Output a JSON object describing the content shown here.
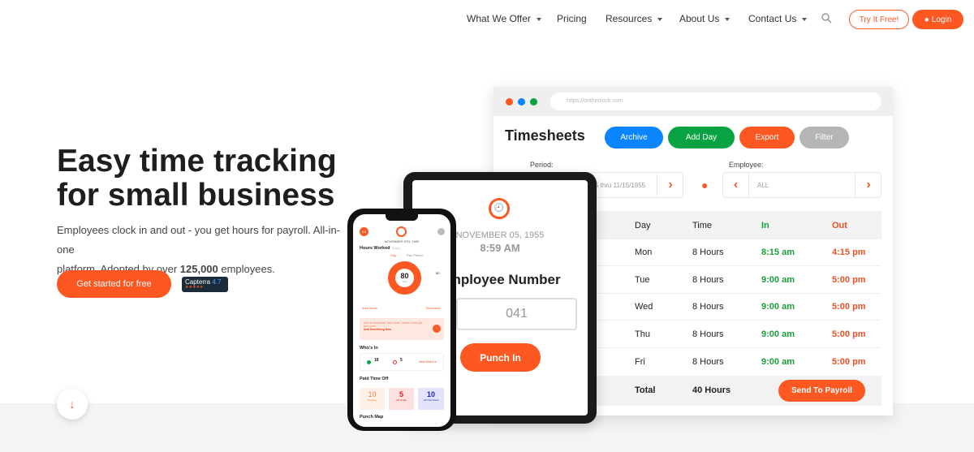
{
  "nav": {
    "items": [
      "What We Offer",
      "Pricing",
      "Resources",
      "About Us",
      "Contact Us"
    ],
    "try_free": "Try It Free!",
    "login": "Login"
  },
  "hero": {
    "title_line1": "Easy time tracking",
    "title_line2": "for small business",
    "desc_1": "Employees clock in and out - you get hours for payroll. All-in-one",
    "desc_2a": "platform. Adopted by over ",
    "desc_2b": "125,000",
    "desc_2c": " employees.",
    "cta": "Get started for free",
    "capterra": "Capterra",
    "capterra_rating": "4.7"
  },
  "browser": {
    "url": "https://ontheclock.com",
    "title": "Timesheets",
    "buttons": {
      "archive": "Archive",
      "add_day": "Add Day",
      "export": "Export",
      "filter": "Filter"
    },
    "period_label": "Period:",
    "period_value": "5 thru 11/15/1955",
    "employee_label": "Employee:",
    "employee_value": "ALL",
    "headers": [
      "Day",
      "Time",
      "In",
      "Out"
    ],
    "rows": [
      [
        "Mon",
        "8 Hours",
        "8:15 am",
        "4:15 pm"
      ],
      [
        "Tue",
        "8 Hours",
        "9:00 am",
        "5:00 pm"
      ],
      [
        "Wed",
        "8 Hours",
        "9:00 am",
        "5:00 pm"
      ],
      [
        "Thu",
        "8 Hours",
        "9:00 am",
        "5:00 pm"
      ],
      [
        "Fri",
        "8 Hours",
        "9:00 am",
        "5:00 pm"
      ]
    ],
    "total_label": "Total",
    "total_value": "40 Hours",
    "send": "Send To Payroll"
  },
  "tablet": {
    "date": "NOVEMBER 05, 1955",
    "time": "8:59 AM",
    "heading": "Employee Number",
    "input": "041",
    "punch": "Punch In"
  },
  "phone": {
    "avatar": "EN",
    "date": "NOVEMBER 5TH, 1955",
    "hours_worked": "Hours Worked",
    "today": "Today",
    "tab_day": "Day",
    "tab_pay": "Pay Period",
    "total": "80",
    "total_label": "Total",
    "side_value": "80",
    "add_hours": "Add Hours",
    "timecards": "Timecards",
    "promo": "Add an employee, add hours, create a new job and more.",
    "promo_link": "Add Something New",
    "whos_in": "Who's In",
    "in_count": "18",
    "in_label": "In",
    "out_count": "5",
    "out_label": "Out",
    "view": "View Who's In",
    "pto": "Paid Time Off",
    "pto_pending": "10",
    "pto_pending_label": "Pending",
    "pto_off": "5",
    "pto_off_label": "Off Today",
    "pto_week": "10",
    "pto_week_label": "Off This Week",
    "punch_map": "Punch Map"
  },
  "colors": {
    "orange": "#fd5722",
    "blue": "#0a84ff",
    "green": "#0aa344",
    "gray": "#b5b5b5"
  }
}
